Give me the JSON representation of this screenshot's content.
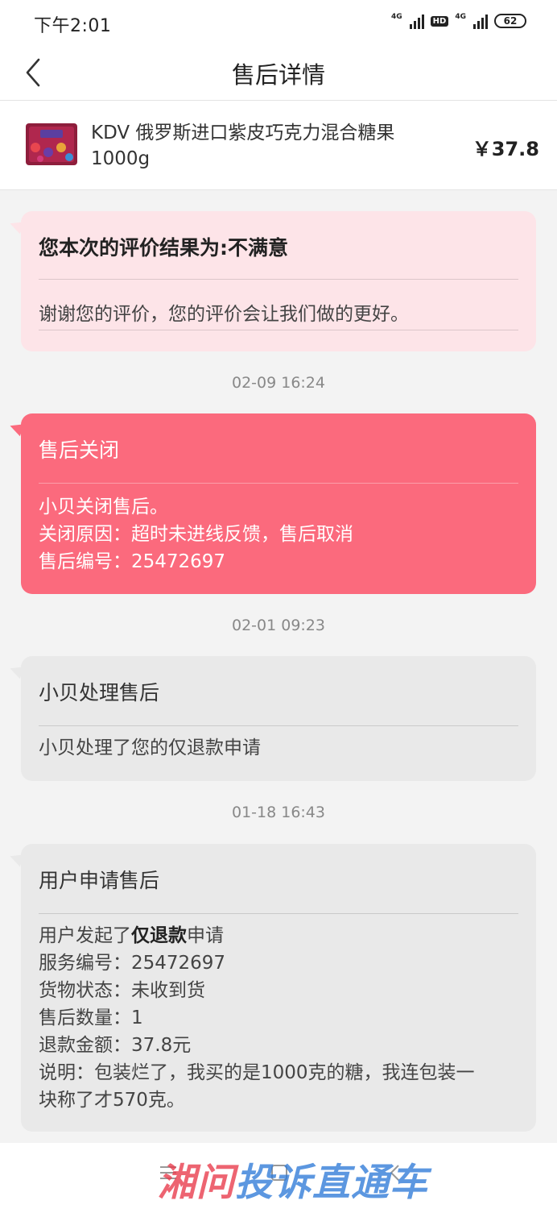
{
  "status_bar": {
    "time": "下午2:01",
    "net1": "4G",
    "hd": "HD",
    "net2": "4G",
    "battery": "62"
  },
  "header": {
    "title": "售后详情"
  },
  "product": {
    "name": "KDV 俄罗斯进口紫皮巧克力混合糖果1000g",
    "price": "￥37.8"
  },
  "cards": [
    {
      "title": "您本次的评价结果为:不满意",
      "lines": [
        "谢谢您的评价，您的评价会让我们做的更好。"
      ]
    },
    {
      "title": "售后关闭",
      "lines": [
        "小贝关闭售后。",
        "关闭原因：超时未进线反馈，售后取消",
        "售后编号：25472697"
      ]
    },
    {
      "title": "小贝处理售后",
      "lines": [
        "小贝处理了您的仅退款申请"
      ]
    },
    {
      "title": "用户申请售后",
      "line0_pre": "用户发起了",
      "line0_bold": "仅退款",
      "line0_post": "申请",
      "lines": [
        "服务编号：25472697",
        "货物状态：未收到货",
        "售后数量：1",
        "退款金额：37.8元",
        "说明：包装烂了，我买的是1000克的糖，我连包装一",
        "块称了才570克。"
      ]
    }
  ],
  "timestamps": [
    "02-09 16:24",
    "02-01 09:23",
    "01-18 16:43"
  ],
  "watermark": {
    "part1": "湘问",
    "part2": "投诉直通车"
  },
  "colors": {
    "accent": "#fb6a7d",
    "pink_card": "#fde4e8",
    "gray_card": "#e9e9e9"
  },
  "icons": [
    "back-arrow-icon",
    "signal-icon",
    "battery-icon",
    "menu-icon",
    "home-icon",
    "back-icon"
  ]
}
